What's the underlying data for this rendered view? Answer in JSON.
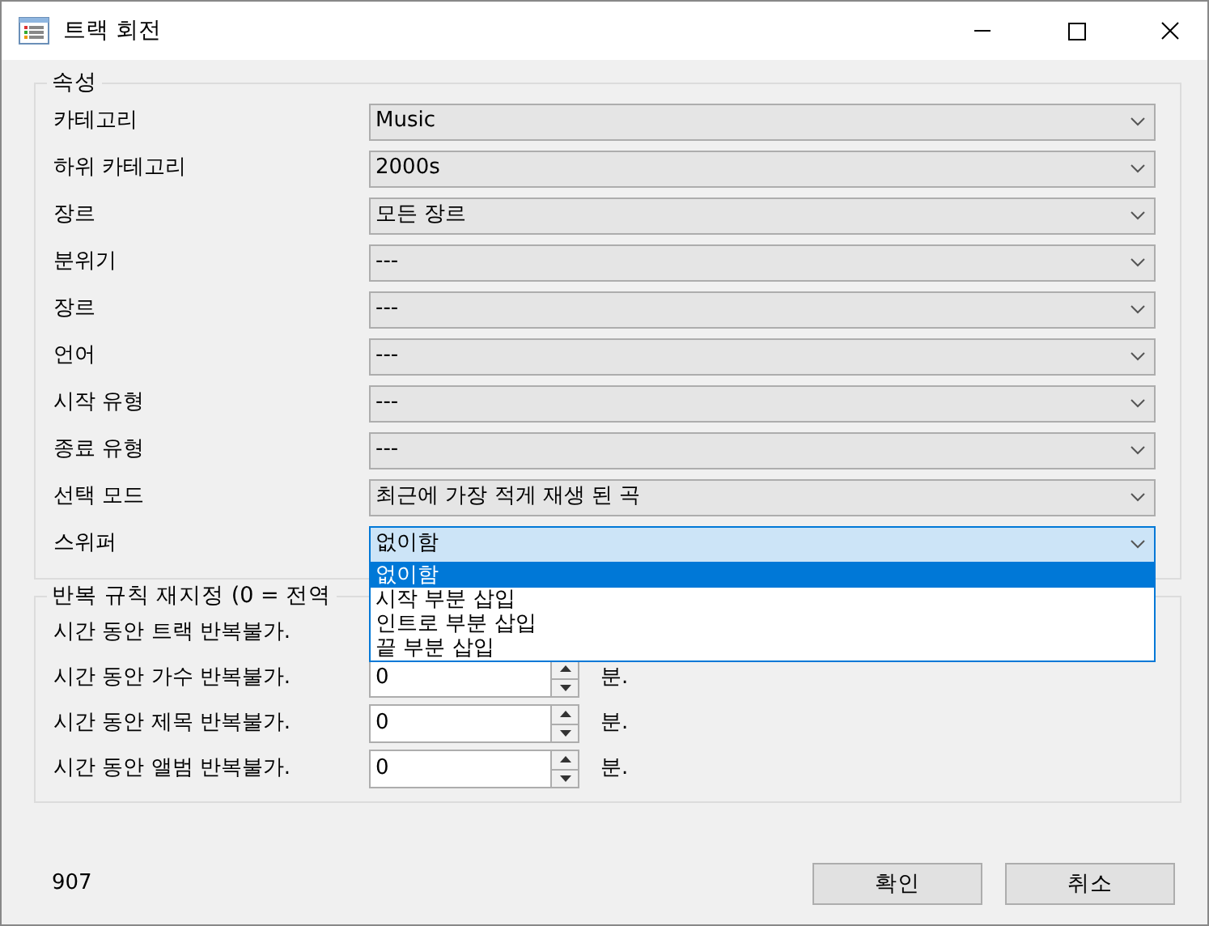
{
  "window": {
    "title": "트랙 회전"
  },
  "properties": {
    "title": "속성",
    "fields": [
      {
        "label": "카테고리",
        "value": "Music",
        "focused": false
      },
      {
        "label": "하위 카테고리",
        "value": "2000s",
        "focused": false
      },
      {
        "label": "장르",
        "value": "모든 장르",
        "focused": false
      },
      {
        "label": "분위기",
        "value": "---",
        "focused": false
      },
      {
        "label": "장르",
        "value": "---",
        "focused": false
      },
      {
        "label": "언어",
        "value": "---",
        "focused": false
      },
      {
        "label": "시작 유형",
        "value": "---",
        "focused": false
      },
      {
        "label": "종료 유형",
        "value": "---",
        "focused": false
      },
      {
        "label": "선택 모드",
        "value": "최근에 가장 적게 재생 된 곡",
        "focused": false
      },
      {
        "label": "스위퍼",
        "value": "없이함",
        "focused": true,
        "options": [
          {
            "label": "없이함",
            "selected": true
          },
          {
            "label": "시작 부분 삽입",
            "selected": false
          },
          {
            "label": "인트로 부분 삽입",
            "selected": false
          },
          {
            "label": "끝 부분 삽입",
            "selected": false
          }
        ]
      }
    ]
  },
  "repeat": {
    "title": "반복 규칙 재지정 (0 = 전역",
    "rows": [
      {
        "label": "시간 동안 트랙 반복불가."
      },
      {
        "label": "시간 동안 가수 반복불가.",
        "value": "0",
        "unit": "분."
      },
      {
        "label": "시간 동안 제목 반복불가.",
        "value": "0",
        "unit": "분."
      },
      {
        "label": "시간 동안 앨범 반복불가.",
        "value": "0",
        "unit": "분."
      }
    ]
  },
  "status": "907",
  "buttons": [
    "확인",
    "취소"
  ]
}
